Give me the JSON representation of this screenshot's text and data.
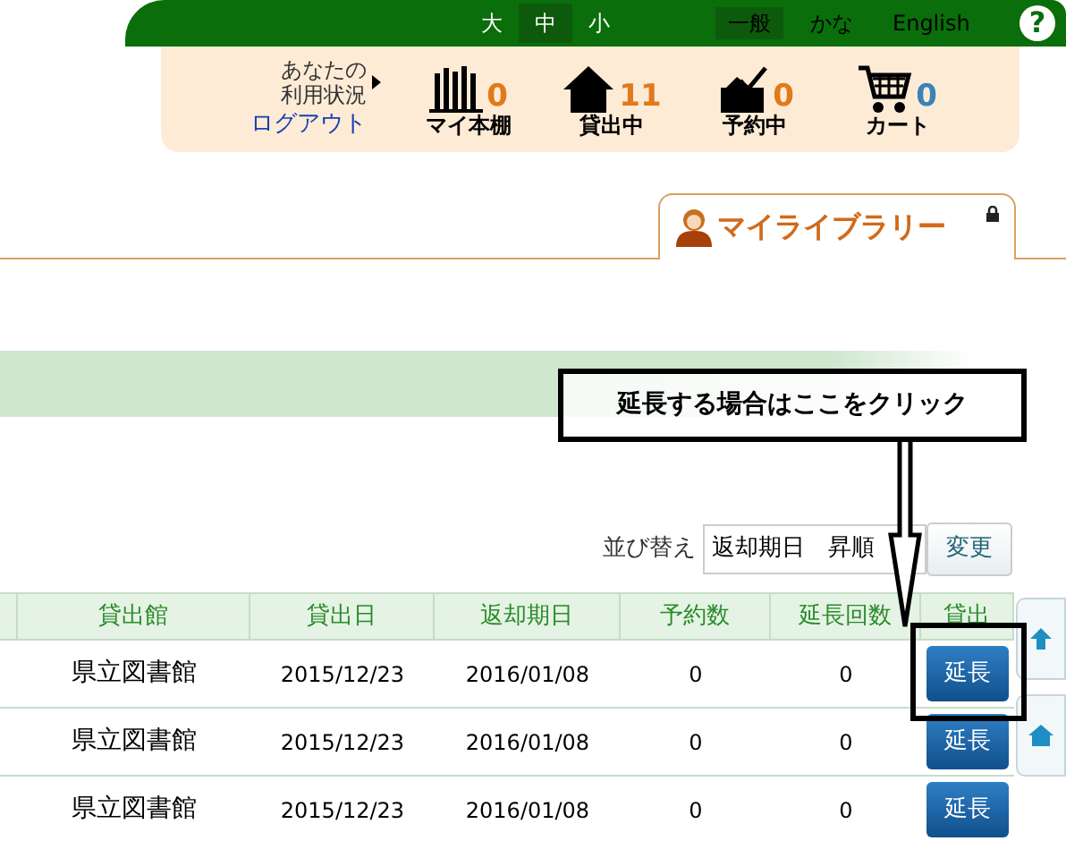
{
  "font_size": [
    {
      "label": "大",
      "selected": false
    },
    {
      "label": "中",
      "selected": true
    },
    {
      "label": "小",
      "selected": false
    }
  ],
  "script_options": [
    {
      "label": "一般",
      "selected": true
    },
    {
      "label": "かな",
      "selected": false
    },
    {
      "label": "English",
      "selected": false
    }
  ],
  "help": "?",
  "usage": {
    "lines": [
      "あなたの",
      "利用状況"
    ],
    "logout": "ログアウト"
  },
  "counters": [
    {
      "kind": "bookshelf",
      "label": "マイ本棚",
      "count": "0",
      "color": "#e07a1a"
    },
    {
      "kind": "house",
      "label": "貸出中",
      "count": "11",
      "color": "#e07a1a"
    },
    {
      "kind": "tray",
      "label": "予約中",
      "count": "0",
      "color": "#e07a1a"
    },
    {
      "kind": "cart",
      "label": "カート",
      "count": "0",
      "color": "#3b82b8"
    }
  ],
  "tab": {
    "label": "マイライブラリー"
  },
  "callout": "延長する場合はここをクリック",
  "sort": {
    "label": "並び替え",
    "value": "返却期日　昇順",
    "button": "変更"
  },
  "table": {
    "columns": [
      "貸出館",
      "貸出日",
      "返却期日",
      "予約数",
      "延長回数",
      "貸出"
    ],
    "rows": [
      {
        "cells": [
          "県立図書館",
          "2015/12/23",
          "2016/01/08",
          "0",
          "0"
        ],
        "button": "延長"
      },
      {
        "cells": [
          "県立図書館",
          "2015/12/23",
          "2016/01/08",
          "0",
          "0"
        ],
        "button": "延長"
      },
      {
        "cells": [
          "県立図書館",
          "2015/12/23",
          "2016/01/08",
          "0",
          "0"
        ],
        "button": "延長"
      }
    ]
  }
}
